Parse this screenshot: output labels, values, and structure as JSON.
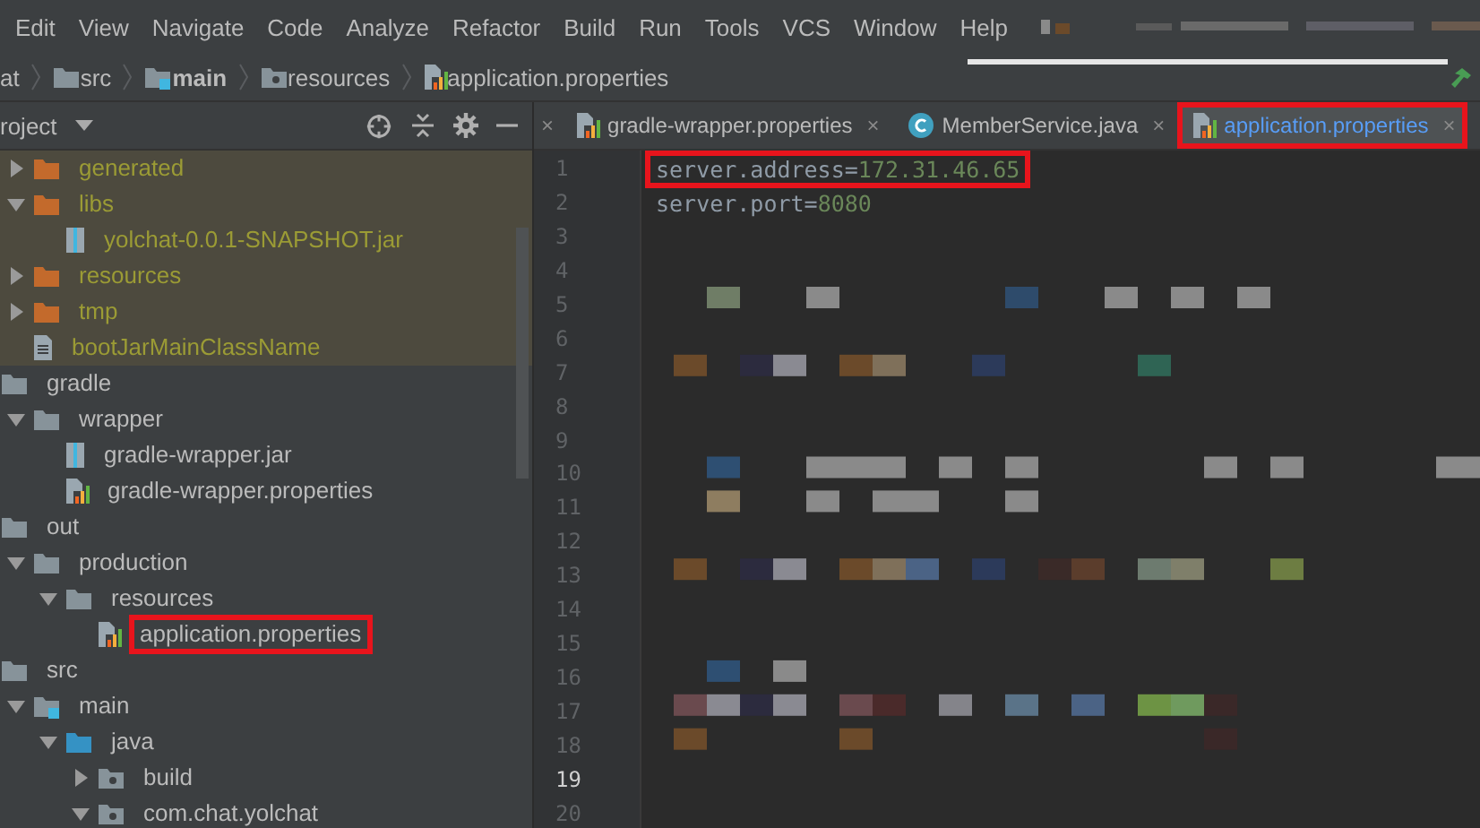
{
  "menu": [
    "Edit",
    "View",
    "Navigate",
    "Code",
    "Analyze",
    "Refactor",
    "Build",
    "Run",
    "Tools",
    "VCS",
    "Window",
    "Help"
  ],
  "breadcrumb": [
    {
      "label": "at",
      "kind": "module"
    },
    {
      "label": "src",
      "kind": "folder"
    },
    {
      "label": "main",
      "kind": "source-root"
    },
    {
      "label": "resources",
      "kind": "resources"
    },
    {
      "label": "application.properties",
      "kind": "properties"
    }
  ],
  "project_panel": {
    "title": "roject",
    "partial_items": [
      {
        "label": "generated",
        "kind": "excluded-folder",
        "expanded": false,
        "excluded": true,
        "highlighted": false
      },
      {
        "label": "libs",
        "kind": "excluded-folder",
        "expanded": true,
        "excluded": true,
        "highlighted": false,
        "children": [
          {
            "label": "yolchat-0.0.1-SNAPSHOT.jar",
            "kind": "jar",
            "excluded": true,
            "highlighted": false
          }
        ]
      },
      {
        "label": "resources",
        "kind": "excluded-folder",
        "expanded": false,
        "excluded": true,
        "highlighted": false
      },
      {
        "label": "tmp",
        "kind": "excluded-folder",
        "expanded": false,
        "excluded": true,
        "highlighted": false
      },
      {
        "label": "bootJarMainClassName",
        "kind": "text-file",
        "excluded": true,
        "highlighted": false
      }
    ],
    "items": [
      {
        "label": "gradle",
        "kind": "folder",
        "expanded": true,
        "excluded": false,
        "highlighted": false,
        "children": [
          {
            "label": "wrapper",
            "kind": "folder",
            "expanded": true,
            "excluded": false,
            "highlighted": false,
            "children": [
              {
                "label": "gradle-wrapper.jar",
                "kind": "jar",
                "excluded": false,
                "highlighted": false
              },
              {
                "label": "gradle-wrapper.properties",
                "kind": "properties",
                "excluded": false,
                "highlighted": false
              }
            ]
          }
        ]
      },
      {
        "label": "out",
        "kind": "folder",
        "expanded": true,
        "excluded": false,
        "highlighted": false,
        "children": [
          {
            "label": "production",
            "kind": "folder",
            "expanded": true,
            "excluded": false,
            "highlighted": false,
            "children": [
              {
                "label": "resources",
                "kind": "folder",
                "expanded": true,
                "excluded": false,
                "highlighted": false,
                "children": [
                  {
                    "label": "application.properties",
                    "kind": "properties",
                    "excluded": false,
                    "highlighted": true
                  }
                ]
              }
            ]
          }
        ]
      },
      {
        "label": "src",
        "kind": "folder",
        "expanded": true,
        "excluded": false,
        "highlighted": false,
        "children": [
          {
            "label": "main",
            "kind": "source-root",
            "expanded": true,
            "excluded": false,
            "highlighted": false,
            "children": [
              {
                "label": "java",
                "kind": "java-source",
                "expanded": true,
                "excluded": false,
                "highlighted": false,
                "children": [
                  {
                    "label": "build",
                    "kind": "package",
                    "expanded": false,
                    "excluded": false,
                    "highlighted": false
                  },
                  {
                    "label": "com.chat.yolchat",
                    "kind": "package",
                    "expanded": true,
                    "excluded": false,
                    "highlighted": false
                  }
                ]
              }
            ]
          }
        ]
      }
    ]
  },
  "tabs": [
    {
      "label": "gradle-wrapper.properties",
      "kind": "properties",
      "selected": false,
      "highlighted": false,
      "close": "×"
    },
    {
      "label": "MemberService.java",
      "kind": "java-class",
      "selected": false,
      "highlighted": false,
      "close": "×"
    },
    {
      "label": "application.properties",
      "kind": "properties",
      "selected": true,
      "highlighted": true,
      "close": "×"
    }
  ],
  "partial_tab_close": "×",
  "editor": {
    "lines": [
      {
        "number": "1",
        "key": "server.address",
        "separator": "=",
        "value": "172.31.46.65",
        "current": false,
        "highlighted": true
      },
      {
        "number": "2",
        "key": "server.port",
        "separator": "=",
        "value": "8080",
        "current": false,
        "highlighted": false
      },
      {
        "number": "3",
        "current": false
      },
      {
        "number": "4",
        "current": false
      },
      {
        "number": "5",
        "current": false
      },
      {
        "number": "6",
        "current": false
      },
      {
        "number": "7",
        "current": false
      },
      {
        "number": "8",
        "current": false
      },
      {
        "number": "9",
        "current": false
      },
      {
        "number": "10",
        "current": false
      },
      {
        "number": "11",
        "current": false
      },
      {
        "number": "12",
        "current": false
      },
      {
        "number": "13",
        "current": false
      },
      {
        "number": "14",
        "current": false
      },
      {
        "number": "15",
        "current": false
      },
      {
        "number": "16",
        "current": false
      },
      {
        "number": "17",
        "current": false
      },
      {
        "number": "18",
        "current": false
      },
      {
        "number": "19",
        "current": true
      },
      {
        "number": "20",
        "current": false
      }
    ]
  }
}
